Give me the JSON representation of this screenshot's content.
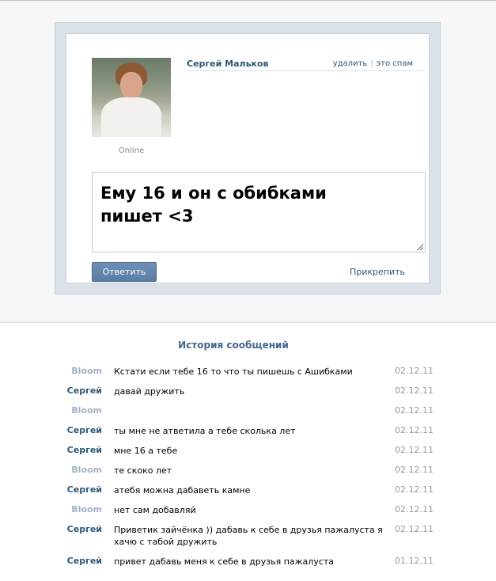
{
  "dialog": {
    "sender_name": "Сергей Мальков",
    "status": "Online",
    "delete_link": "удалить",
    "spam_link": "это спам",
    "message_text": "Ему 16 и он с обибками пишет <3",
    "reply_button": "Ответить",
    "attach_link": "Прикрепить"
  },
  "history": {
    "title": "История сообщений",
    "rows": [
      {
        "author": "Bloom",
        "text": "Кстати если тебе 16 то что ты пишешь с Ашибками",
        "date": "02.12.11"
      },
      {
        "author": "Сергей",
        "text": "давай дружить",
        "date": "02.12.11"
      },
      {
        "author": "Bloom",
        "text": "",
        "date": "02.12.11"
      },
      {
        "author": "Сергей",
        "text": "ты мне не атветила а тебе сколька лет",
        "date": "02.12.11"
      },
      {
        "author": "Сергей",
        "text": "мне 16 а тебе",
        "date": "02.12.11"
      },
      {
        "author": "Bloom",
        "text": "те скоко лет",
        "date": "02.12.11"
      },
      {
        "author": "Сергей",
        "text": "атебя можна дабаветь камне",
        "date": "02.12.11"
      },
      {
        "author": "Bloom",
        "text": "нет сам добавляй",
        "date": "02.12.11"
      },
      {
        "author": "Сергей",
        "text": "Приветик зайчёнка )) дабавь к себе в друзья пажалуста я хачю с табой дружить",
        "date": "02.12.11"
      },
      {
        "author": "Сергей",
        "text": "привет дабавь меня к себе в друзья пажалуста",
        "date": "01.12.11"
      }
    ]
  }
}
